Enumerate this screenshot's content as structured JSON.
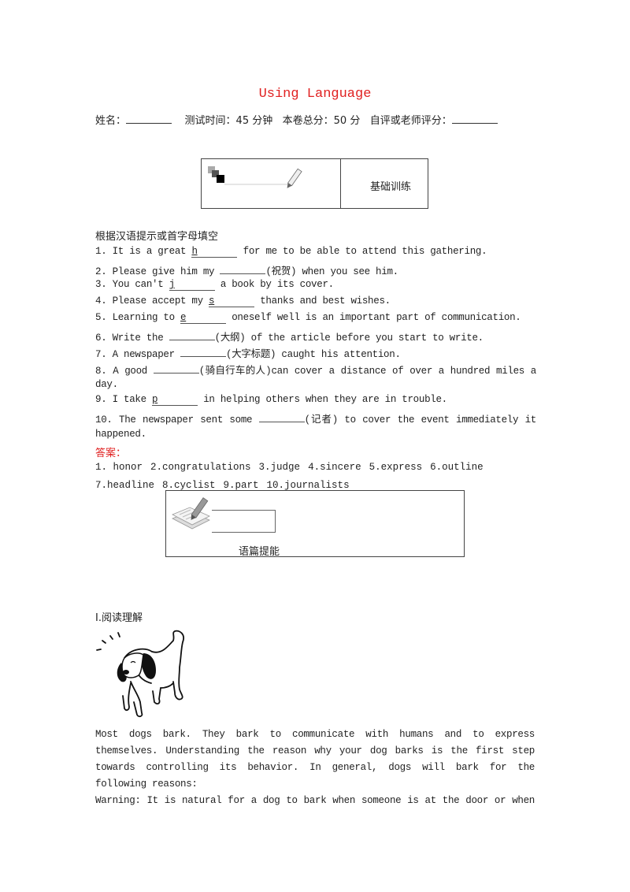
{
  "doc": {
    "title": "Using Language",
    "header": {
      "name_label": "姓名：",
      "time_label": "测试时间：45 分钟",
      "total_label": "本卷总分：50 分",
      "grade_label": "自评或老师评分："
    },
    "section_basic": {
      "label": "基础训练",
      "icon": "pencil-squares-icon"
    },
    "instruction": "根据汉语提示或首字母填空",
    "questions": [
      {
        "num": "1.",
        "before": "It is a great ",
        "hint": "h",
        "after": " for me to be able to attend this gathering."
      },
      {
        "num": "2.",
        "before": "Please give him my ",
        "hint": "",
        "after": "(祝贺) when you see him."
      },
      {
        "num": "3.",
        "before": "You can't ",
        "hint": "j",
        "after": " a book by its cover."
      },
      {
        "num": "4.",
        "before": "Please accept my ",
        "hint": "s",
        "after": " thanks and best wishes."
      },
      {
        "num": "5.",
        "before": "Learning to ",
        "hint": "e",
        "after": " oneself well is an important part of communication."
      },
      {
        "num": "6.",
        "before": "Write the ",
        "hint": "",
        "after": "(大纲) of the article before you start to write."
      },
      {
        "num": "7.",
        "before": "A newspaper ",
        "hint": "",
        "after": "(大字标题) caught his attention."
      },
      {
        "num": "8.",
        "before": "A good ",
        "hint": "",
        "after": "(骑自行车的人)can cover a distance of over a hundred miles a",
        "continuation": "day."
      },
      {
        "num": "9.",
        "before": "I take ",
        "hint": "p",
        "after": " in helping others when they are in trouble."
      },
      {
        "num": "10.",
        "before": "The newspaper sent some ",
        "hint": "",
        "after": "(记者) to cover the event immediately it",
        "continuation": "happened."
      }
    ],
    "answer_label": "答案：",
    "answers_line1": [
      "1. honor",
      "2.congratulations",
      "3.judge",
      "4.sincere",
      "5.express",
      "6.outline"
    ],
    "answers_line2": [
      "7.headline",
      "8.cyclist",
      "9.part",
      "10.journalists"
    ],
    "section_passage": {
      "label": "语篇提能",
      "icon": "notepad-pen-icon"
    },
    "reading_heading": "Ⅰ.阅读理解",
    "reading_image": "barking-dog-illustration",
    "paragraphs": [
      "Most dogs bark. They bark to communicate with humans and to express themselves. Understanding the reason why your dog barks is the first step towards controlling its behavior. In general, dogs will bark for the following reasons:",
      "Warning: It is natural for a dog to bark when someone is at the door or when"
    ],
    "colors": {
      "accent_red": "#e02020"
    }
  }
}
